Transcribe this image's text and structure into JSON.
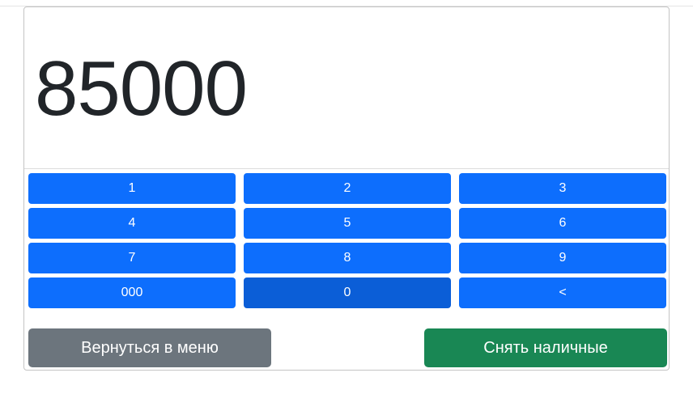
{
  "display": {
    "value": "85000"
  },
  "keypad": {
    "keys": [
      {
        "label": "1",
        "name": "key-1"
      },
      {
        "label": "2",
        "name": "key-2"
      },
      {
        "label": "3",
        "name": "key-3"
      },
      {
        "label": "4",
        "name": "key-4"
      },
      {
        "label": "5",
        "name": "key-5"
      },
      {
        "label": "6",
        "name": "key-6"
      },
      {
        "label": "7",
        "name": "key-7"
      },
      {
        "label": "8",
        "name": "key-8"
      },
      {
        "label": "9",
        "name": "key-9"
      },
      {
        "label": "000",
        "name": "key-triple-zero"
      },
      {
        "label": "0",
        "name": "key-0"
      },
      {
        "label": "<",
        "name": "key-backspace"
      }
    ]
  },
  "actions": {
    "back_label": "Вернуться в меню",
    "withdraw_label": "Снять наличные"
  },
  "colors": {
    "key_blue": "#0d6efd",
    "key_active": "#0b5ed7",
    "back_gray": "#6c757d",
    "withdraw_green": "#198754"
  }
}
